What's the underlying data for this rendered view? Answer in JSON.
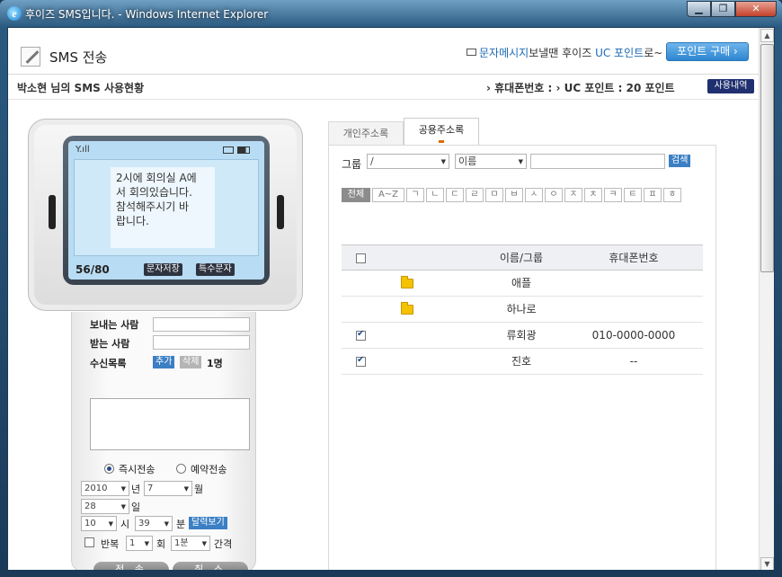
{
  "window": {
    "title": "후이즈 SMS입니다. - Windows Internet Explorer",
    "min": "▁",
    "max": "❐",
    "close": "✕"
  },
  "header": {
    "title": "SMS 전송",
    "promo_prefix": "문자메시지",
    "promo_mid": "보낼땐 후이즈 ",
    "promo_link": "UC 포인트",
    "promo_suffix": "로~",
    "buy_button": "포인트 구매 ›"
  },
  "usage": {
    "title": "박소현 님의 SMS 사용현황",
    "info": "› 휴대폰번호 : › UC 포인트 : 20 포인트",
    "history_button": "사용내역"
  },
  "phone": {
    "signal": "Y.ıll",
    "message": "2시에 회의실 A에\n서 회의있습니다.\n참석해주시기 바\n랍니다.",
    "counter": "56/80",
    "save_button": "문자저장",
    "special_button": "특수문자"
  },
  "form": {
    "sender_label": "보내는 사람",
    "receiver_label": "받는 사람",
    "list_label": "수신목록",
    "add_button": "추가",
    "delete_button": "삭제",
    "recipient_count": "1명",
    "send_now": "즉시전송",
    "reserve": "예약전송",
    "year": "2010",
    "year_unit": "년",
    "month": "7",
    "month_unit": "월",
    "day": "28",
    "day_unit": "일",
    "hour": "10",
    "hour_unit": "시",
    "minute": "39",
    "minute_unit": "분",
    "calendar_button": "달력보기",
    "repeat_label": "반복",
    "repeat_count": "1",
    "repeat_unit": "회",
    "interval": "1분",
    "interval_label": "간격",
    "send_button": "전 송",
    "cancel_button": "취 소"
  },
  "addressbook": {
    "tabs": [
      "개인주소록",
      "공용주소록"
    ],
    "group_label": "그룹",
    "group_value": "/",
    "field_value": "이름",
    "search_button": "검색",
    "chosung": [
      "전체",
      "A~Z",
      "ㄱ",
      "ㄴ",
      "ㄷ",
      "ㄹ",
      "ㅁ",
      "ㅂ",
      "ㅅ",
      "ㅇ",
      "ㅈ",
      "ㅊ",
      "ㅋ",
      "ㅌ",
      "ㅍ",
      "ㅎ"
    ],
    "col_name": "이름/그룹",
    "col_phone": "휴대폰번호",
    "rows": [
      {
        "name": "애플",
        "phone": ""
      },
      {
        "name": "하나로",
        "phone": ""
      },
      {
        "name": "류회광",
        "phone": "010-0000-0000"
      },
      {
        "name": "진호",
        "phone": "--"
      }
    ]
  }
}
